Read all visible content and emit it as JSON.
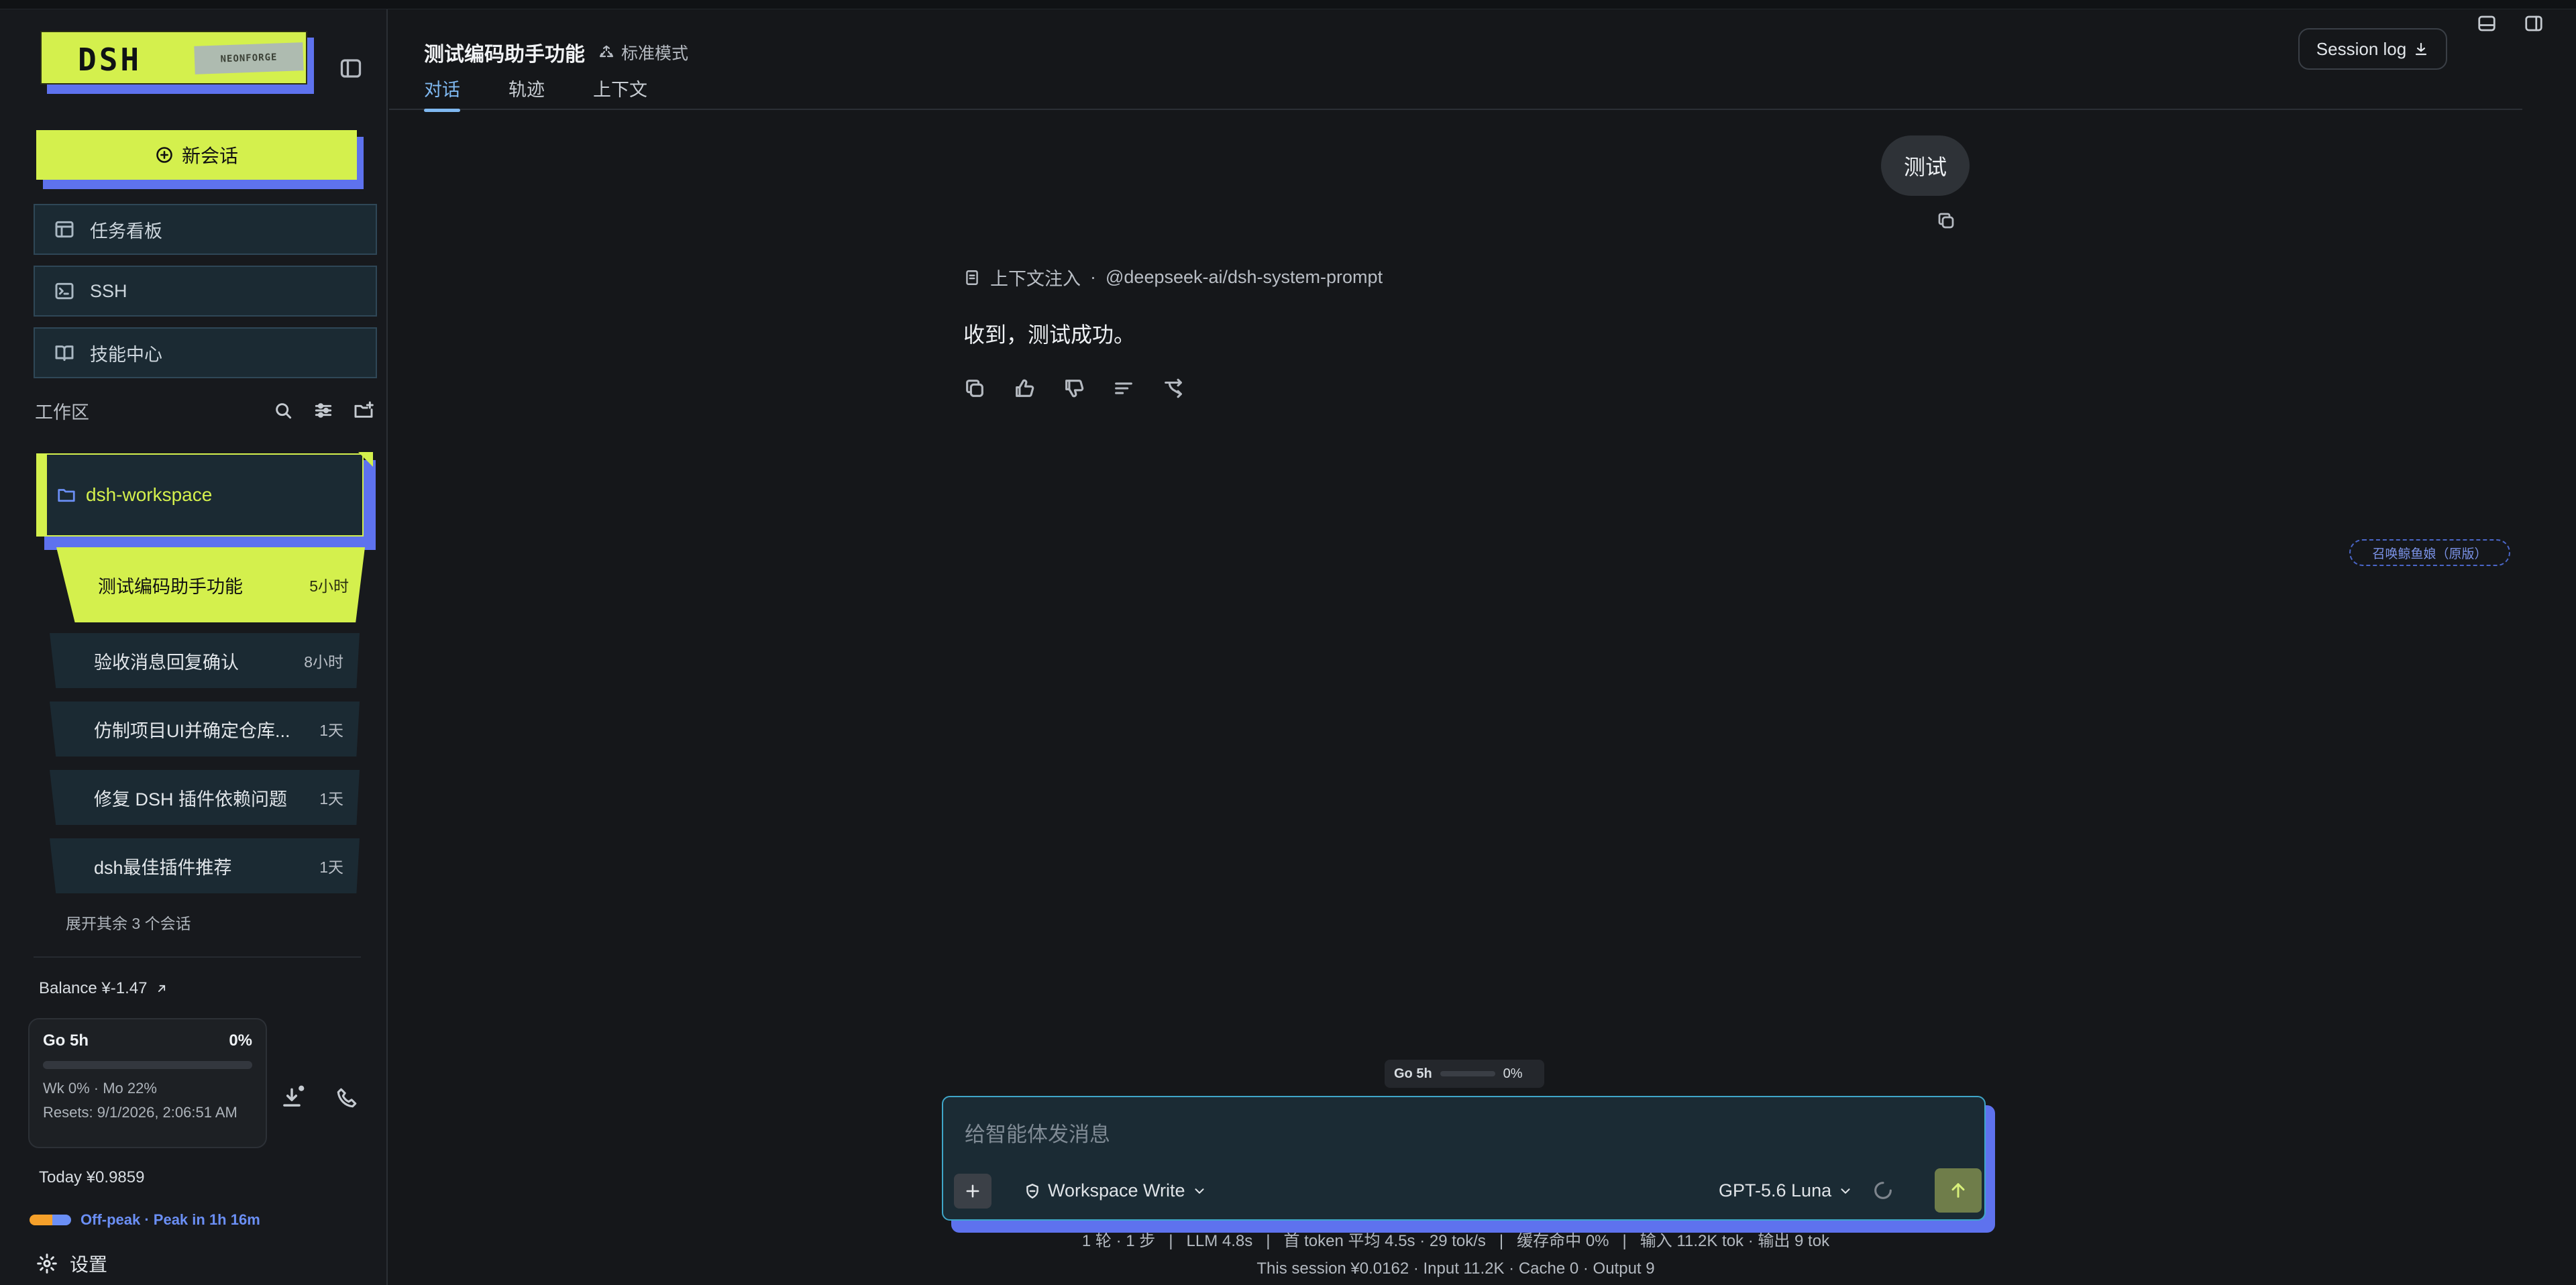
{
  "sidebar": {
    "brand": "DSH",
    "brand_tag": "NEONFORGE",
    "new_chat": "新会话",
    "nav": [
      {
        "label": "任务看板",
        "icon": "board-icon"
      },
      {
        "label": "SSH",
        "icon": "terminal-icon"
      },
      {
        "label": "技能中心",
        "icon": "book-icon"
      }
    ],
    "workspace_label": "工作区",
    "folder": "dsh-workspace",
    "sessions": [
      {
        "title": "测试编码助手功能",
        "age": "5小时"
      },
      {
        "title": "验收消息回复确认",
        "age": "8小时"
      },
      {
        "title": "仿制项目UI并确定仓库...",
        "age": "1天"
      },
      {
        "title": "修复 DSH 插件依赖问题",
        "age": "1天"
      },
      {
        "title": "dsh最佳插件推荐",
        "age": "1天"
      }
    ],
    "expand_more": "展开其余 3 个会话",
    "balance": "Balance ¥-1.47",
    "usage": {
      "title": "Go 5h",
      "percent": "0%",
      "week_line": "Wk 0% · Mo 22%",
      "resets": "Resets: 9/1/2026, 2:06:51 AM"
    },
    "today": "Today ¥0.9859",
    "offpeak": "Off-peak · Peak in 1h 16m",
    "settings": "设置"
  },
  "header": {
    "title": "测试编码助手功能",
    "mode": "标准模式",
    "tabs": [
      "对话",
      "轨迹",
      "上下文"
    ],
    "session_log": "Session log"
  },
  "chat": {
    "user_message": "测试",
    "context_label": "上下文注入",
    "context_source": "@deepseek-ai/dsh-system-prompt",
    "reply": "收到，测试成功。"
  },
  "summon": "召唤鲸鱼娘（原版）",
  "composer": {
    "go_label": "Go 5h",
    "go_percent": "0%",
    "placeholder": "给智能体发消息",
    "permission": "Workspace Write",
    "model": "GPT-5.6 Luna"
  },
  "stats": {
    "line1": "1 轮 · 1 步   |   LLM 4.8s   |   首 token 平均 4.5s · 29 tok/s   |   缓存命中 0%   |   输入 11.2K tok · 输出 9 tok",
    "line2": "This session ¥0.0162 · Input 11.2K · Cache 0 · Output 9"
  },
  "colors": {
    "accent": "#d4f04d",
    "shadow": "#5e72ee",
    "link": "#7fb8f0"
  }
}
